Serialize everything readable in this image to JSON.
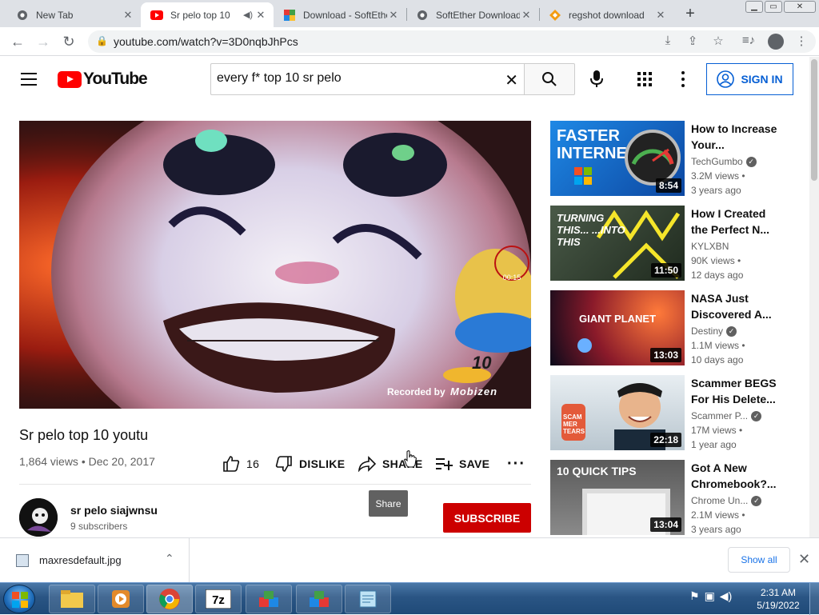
{
  "browser": {
    "tabs": [
      {
        "title": "New Tab",
        "icon": "chrome-icon"
      },
      {
        "title": "Sr pelo top 10",
        "icon": "youtube-icon",
        "active": true,
        "audio": true
      },
      {
        "title": "Download - SoftEther",
        "icon": "softether-icon"
      },
      {
        "title": "SoftEther Download",
        "icon": "chrome-icon"
      },
      {
        "title": "regshot download",
        "icon": "regshot-icon"
      }
    ],
    "url": "youtube.com/watch?v=3D0nqbJhPcs"
  },
  "youtube": {
    "logo_text": "YouTube",
    "search_value": "every f* top 10 sr pelo",
    "signin_label": "SIGN IN"
  },
  "video": {
    "title": "Sr pelo top 10 youtu",
    "views": "1,864 views",
    "date": "Dec 20, 2017",
    "likes": "16",
    "dislike_label": "DISLIKE",
    "share_label": "SHARE",
    "save_label": "SAVE",
    "overlay_recorded": "Recorded by",
    "overlay_brand": "Mobizen",
    "overlay_timer": "00:15",
    "overlay_badge": "10"
  },
  "channel": {
    "name": "sr pelo siajwnsu",
    "subscribers": "9 subscribers",
    "subscribe_label": "SUBSCRIBE"
  },
  "tooltip": "Share",
  "recommendations": [
    {
      "title": "How to Increase Your...",
      "channel": "TechGumbo",
      "verified": true,
      "views": "3.2M views •",
      "age": "3 years ago",
      "duration": "8:54",
      "thumb_text": "FASTER INTERNET"
    },
    {
      "title": "How I Created the Perfect N...",
      "channel": "KYLXBN",
      "verified": false,
      "views": "90K views •",
      "age": "12 days ago",
      "duration": "11:50",
      "thumb_text": "TURNING THIS... ...INTO THIS"
    },
    {
      "title": "NASA Just Discovered A...",
      "channel": "Destiny",
      "verified": true,
      "views": "1.1M views •",
      "age": "10 days ago",
      "duration": "13:03",
      "thumb_text": "GIANT PLANET"
    },
    {
      "title": "Scammer BEGS For His Delete...",
      "channel": "Scammer P...",
      "verified": true,
      "views": "17M views •",
      "age": "1 year ago",
      "duration": "22:18",
      "thumb_text": "SCAM MER TEARS"
    },
    {
      "title": "Got A New Chromebook?...",
      "channel": "Chrome Un...",
      "verified": true,
      "views": "2.1M views •",
      "age": "3 years ago",
      "duration": "13:04",
      "thumb_text": "10 QUICK TIPS"
    }
  ],
  "download": {
    "filename": "maxresdefault.jpg",
    "show_all": "Show all"
  },
  "taskbar": {
    "time": "2:31 AM",
    "date": "5/19/2022"
  }
}
